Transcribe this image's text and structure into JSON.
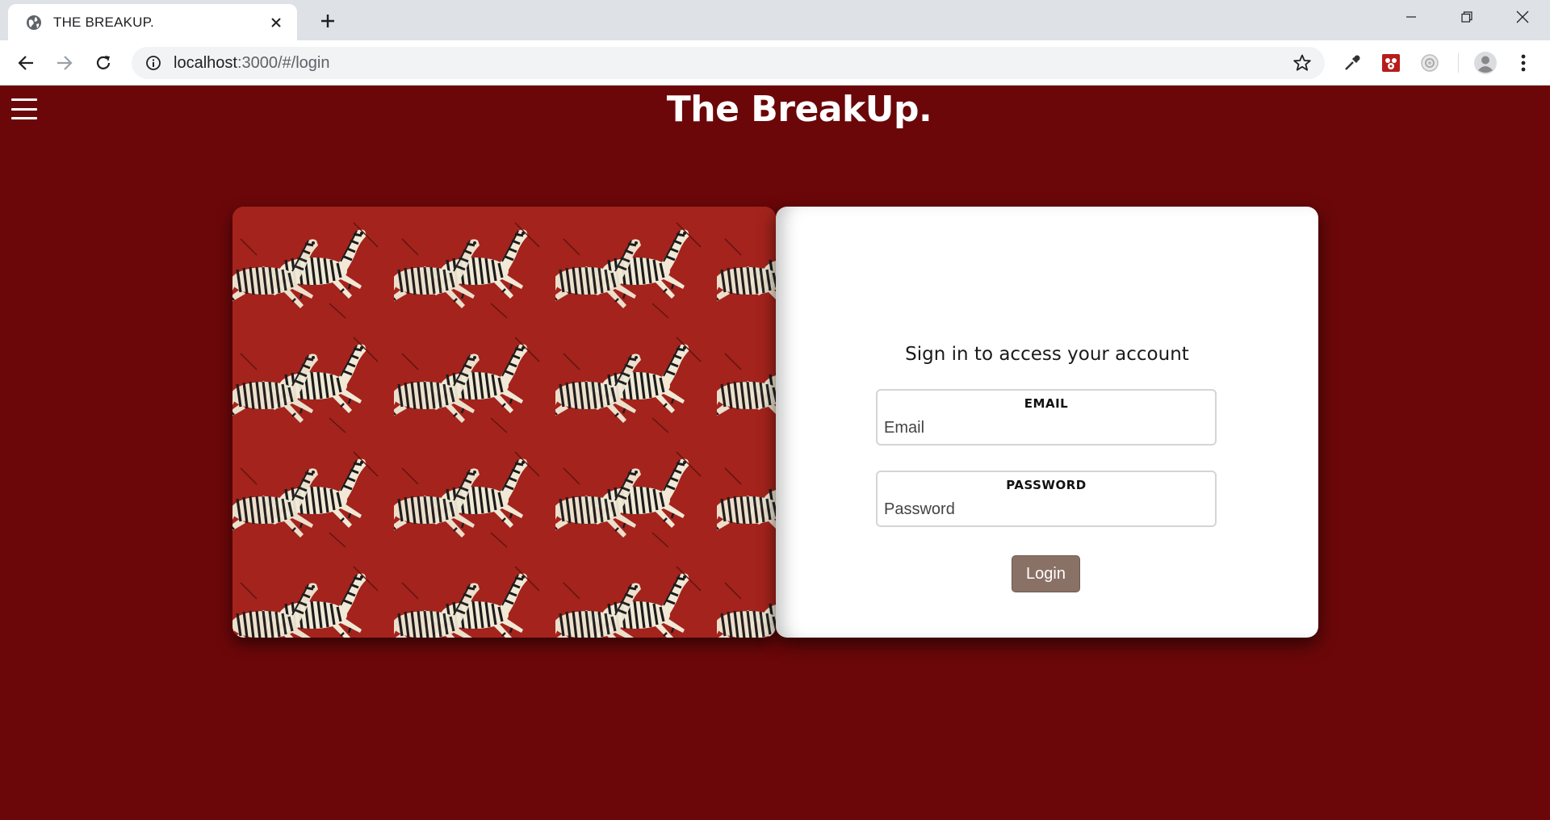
{
  "browser": {
    "tab_title": "THE BREAKUP.",
    "url_host": "localhost",
    "url_path": ":3000/#/login"
  },
  "page": {
    "site_title": "The BreakUp.",
    "signin_heading": "Sign in to access your account",
    "email": {
      "label": "EMAIL",
      "placeholder": "Email"
    },
    "password": {
      "label": "PASSWORD",
      "placeholder": "Password"
    },
    "login_label": "Login"
  },
  "colors": {
    "page_background": "#6b0709",
    "pattern_background": "#a4231c",
    "login_button": "#8a7166"
  },
  "icons": [
    "globe-icon",
    "close-icon",
    "plus-icon",
    "minimize-icon",
    "restore-icon",
    "window-close-icon",
    "back-arrow-icon",
    "forward-arrow-icon",
    "reload-icon",
    "info-icon",
    "star-icon",
    "eyedropper-icon",
    "extension-icon",
    "camera-extension-icon",
    "profile-icon",
    "kebab-menu-icon",
    "hamburger-icon",
    "zebra-icon"
  ]
}
